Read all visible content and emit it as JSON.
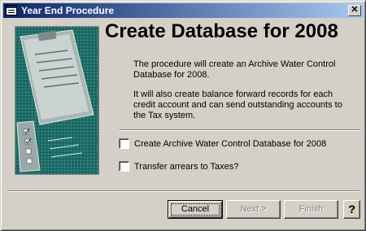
{
  "window": {
    "title": "Year End Procedure",
    "close_glyph": "✕"
  },
  "heading": "Create Database for 2008",
  "description": [
    "The procedure will create an Archive Water Control Database for 2008.",
    "It will also create balance forward records for each credit account and can send outstanding accounts to the Tax system."
  ],
  "options": [
    {
      "label": "Create Archive Water Control Database for 2008",
      "checked": false
    },
    {
      "label": "Transfer arrears to Taxes?",
      "checked": false
    }
  ],
  "buttons": {
    "cancel": "Cancel",
    "next": "Next >",
    "finish": "Finish",
    "help": "?"
  },
  "icons": {
    "title_icon": "form-icon",
    "art": "clipboard-illustration",
    "help": "question-mark-icon"
  },
  "colors": {
    "titlebar_start": "#0a246a",
    "titlebar_end": "#a6caf0",
    "face": "#d4d0c8",
    "art_bg": "#1f6f6a"
  }
}
